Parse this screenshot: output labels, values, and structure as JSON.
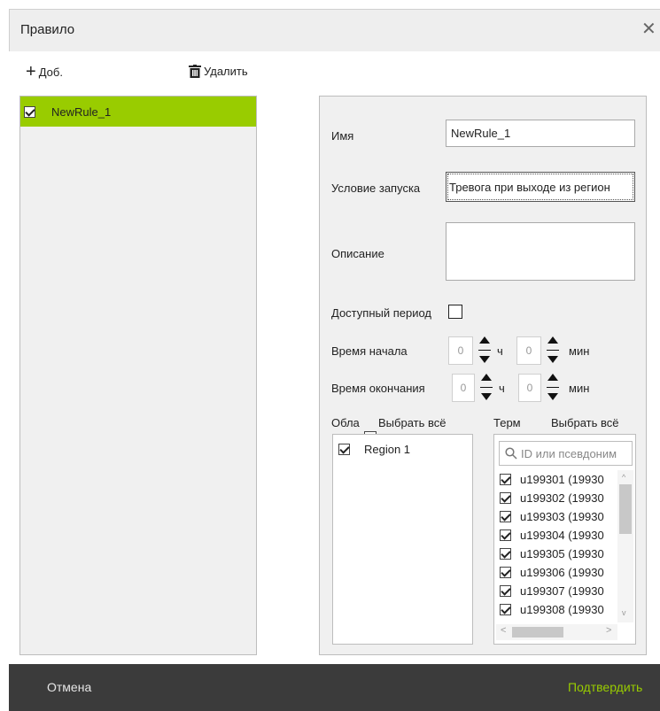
{
  "dialog": {
    "title": "Правило",
    "close_icon": "close-icon"
  },
  "toolbar": {
    "add_label": "Доб.",
    "delete_label": "Удалить"
  },
  "rules": [
    {
      "name": "NewRule_1",
      "checked": true,
      "selected": true
    }
  ],
  "form": {
    "name_label": "Имя",
    "name_value": "NewRule_1",
    "trigger_label": "Условие запуска",
    "trigger_value": "Тревога при выходе из регион",
    "description_label": "Описание",
    "description_value": "",
    "period_label": "Доступный период",
    "start_label": "Время начала",
    "end_label": "Время окончания",
    "start_hours": "0",
    "start_minutes": "0",
    "end_hours": "0",
    "end_minutes": "0",
    "hours_unit": "ч",
    "minutes_unit": "мин"
  },
  "area": {
    "header_label": "Обла",
    "select_all_label": "Выбрать всё",
    "items": [
      {
        "label": "Region 1",
        "checked": true
      }
    ]
  },
  "terminals": {
    "header_label": "Терм",
    "select_all_label": "Выбрать всё",
    "search_placeholder": "ID или псевдоним",
    "items": [
      {
        "label": "u199301 (19930",
        "checked": true
      },
      {
        "label": "u199302 (19930",
        "checked": true
      },
      {
        "label": "u199303 (19930",
        "checked": true
      },
      {
        "label": "u199304 (19930",
        "checked": true
      },
      {
        "label": "u199305 (19930",
        "checked": true
      },
      {
        "label": "u199306 (19930",
        "checked": true
      },
      {
        "label": "u199307 (19930",
        "checked": true
      },
      {
        "label": "u199308 (19930",
        "checked": true
      }
    ]
  },
  "footer": {
    "cancel_label": "Отмена",
    "confirm_label": "Подтвердить"
  },
  "colors": {
    "accent": "#99cc00",
    "confirm_text": "#99cc00",
    "footer_bg": "#3b3b3b"
  }
}
